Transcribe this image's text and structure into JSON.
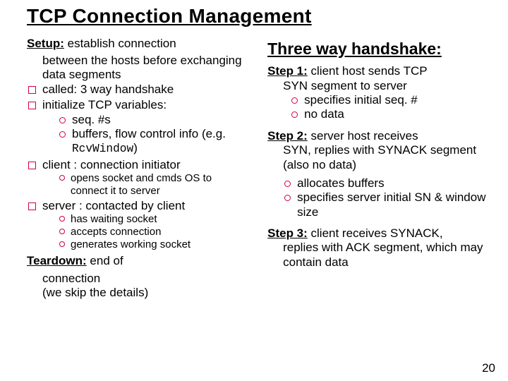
{
  "title": "TCP Connection Management",
  "left": {
    "setup_label": "Setup:",
    "setup_text": " establish connection",
    "setup_cont": "between the hosts before exchanging data segments",
    "b1": "called: 3 way handshake",
    "b2": "initialize TCP variables:",
    "b2s1": "seq. #s",
    "b2s2_a": "buffers, flow control info (e.g. ",
    "b2s2_b": "RcvWindow",
    "b2s2_c": ")",
    "b3": "client : connection initiator",
    "b3s1": "opens socket and cmds OS to connect it to server",
    "b4": "server : contacted by client",
    "b4s1": "has waiting socket",
    "b4s2": "accepts connection",
    "b4s3": "generates working socket",
    "teardown_label": "Teardown:",
    "teardown_text": " end of",
    "teardown_cont": "connection\n(we skip the details)"
  },
  "right": {
    "heading": "Three way handshake:",
    "s1_label": "Step 1:",
    "s1_text": " client host sends TCP",
    "s1_cont": "SYN segment to server",
    "s1s1": "specifies initial seq. #",
    "s1s2": "no data",
    "s2_label": "Step 2:",
    "s2_text": " server host receives",
    "s2_cont": "SYN, replies with SYNACK segment (also no data)",
    "s2s1": "allocates buffers",
    "s2s2": "specifies server initial SN & window size",
    "s3_label": "Step 3:",
    "s3_text": " client receives SYNACK,",
    "s3_cont": "replies with ACK segment, which may contain data"
  },
  "pagenum": "20"
}
